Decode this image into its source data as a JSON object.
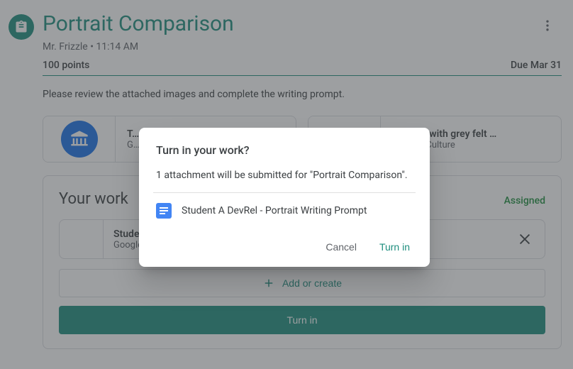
{
  "header": {
    "title": "Portrait Comparison",
    "teacher": "Mr. Frizzle",
    "time": "11:14 AM",
    "separator": " • "
  },
  "meta": {
    "points": "100 points",
    "due": "Due Mar 31"
  },
  "description": "Please review the attached images and complete the writing prompt.",
  "attachments": [
    {
      "title": "T…",
      "subtitle": "G…"
    },
    {
      "title": "…ortrait with grey felt …",
      "subtitle": "…Arts & Culture"
    }
  ],
  "work": {
    "heading": "Your work",
    "status": "Assigned",
    "file_title": "Studer…",
    "file_subtitle": "Google …",
    "add_label": "Add or create",
    "turn_in_label": "Turn in"
  },
  "dialog": {
    "title": "Turn in your work?",
    "body": "1 attachment will be submitted for \"Portrait Comparison\".",
    "file": "Student A DevRel - Portrait Writing Prompt",
    "cancel": "Cancel",
    "confirm": "Turn in"
  }
}
